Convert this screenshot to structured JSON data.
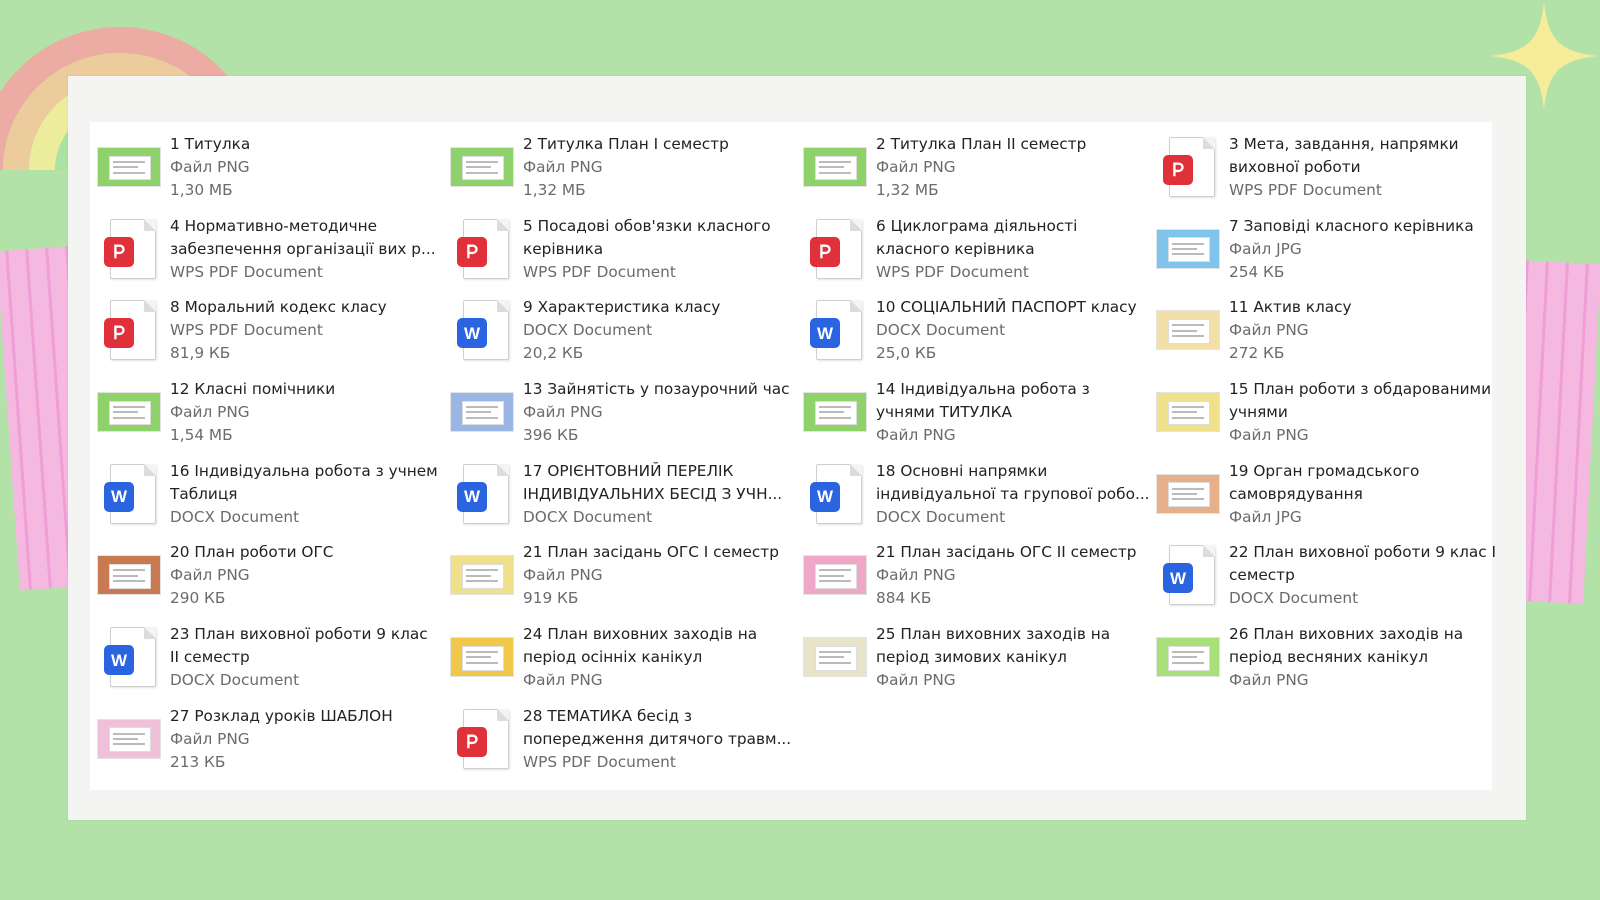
{
  "colors": {
    "background": "#b3e2a8",
    "sheet": "#f4f4f2",
    "panel": "#ffffff",
    "pdf_badge": "#e0303a",
    "word_badge": "#2a64e0",
    "tape": "#f7b6e4",
    "star": "#f7ec9a"
  },
  "icons": {
    "pdf": "wps-pdf-icon",
    "word": "word-docx-icon",
    "png": "image-thumbnail-icon",
    "jpg": "image-thumbnail-icon"
  },
  "files": [
    {
      "lines": [
        "1 Титулка"
      ],
      "type": "Файл PNG",
      "size": "1,30 МБ",
      "kind": "png",
      "tint": "#8fd16a"
    },
    {
      "lines": [
        "2 Титулка План І семестр"
      ],
      "type": "Файл PNG",
      "size": "1,32 МБ",
      "kind": "png",
      "tint": "#8fd16a"
    },
    {
      "lines": [
        "2 Титулка План ІІ семестр"
      ],
      "type": "Файл PNG",
      "size": "1,32 МБ",
      "kind": "png",
      "tint": "#8fd16a"
    },
    {
      "lines": [
        "3 Мета, завдання, напрямки",
        "виховної роботи"
      ],
      "type": "WPS PDF Document",
      "size": "",
      "kind": "pdf"
    },
    {
      "lines": [
        "4 Нормативно-методичне",
        "забезпечення організації вих р..."
      ],
      "type": "WPS PDF Document",
      "size": "",
      "kind": "pdf"
    },
    {
      "lines": [
        "5 Посадові обов'язки класного",
        "керівника"
      ],
      "type": "WPS PDF Document",
      "size": "",
      "kind": "pdf"
    },
    {
      "lines": [
        "6 Циклограма діяльності",
        "класного керівника"
      ],
      "type": "WPS PDF Document",
      "size": "",
      "kind": "pdf"
    },
    {
      "lines": [
        "7 Заповіді класного керівника"
      ],
      "type": "Файл JPG",
      "size": "254 КБ",
      "kind": "jpg",
      "tint": "#7fc4ec"
    },
    {
      "lines": [
        "8 Моральний кодекс класу"
      ],
      "type": "WPS PDF Document",
      "size": "81,9 КБ",
      "kind": "pdf"
    },
    {
      "lines": [
        "9 Характеристика класу"
      ],
      "type": "DOCX Document",
      "size": "20,2 КБ",
      "kind": "word"
    },
    {
      "lines": [
        "10 СОЦІАЛЬНИЙ ПАСПОРТ класу"
      ],
      "type": "DOCX Document",
      "size": "25,0 КБ",
      "kind": "word"
    },
    {
      "lines": [
        "11 Актив класу"
      ],
      "type": "Файл PNG",
      "size": "272 КБ",
      "kind": "png",
      "tint": "#f3dfa8"
    },
    {
      "lines": [
        "12 Класні помічники"
      ],
      "type": "Файл PNG",
      "size": "1,54 МБ",
      "kind": "png",
      "tint": "#8fd16a"
    },
    {
      "lines": [
        "13 Зайнятість у позаурочний час"
      ],
      "type": "Файл PNG",
      "size": "396 КБ",
      "kind": "png",
      "tint": "#9bb6e4"
    },
    {
      "lines": [
        "14 Індивідуальна робота з",
        "учнями ТИТУЛКА"
      ],
      "type": "Файл PNG",
      "size": "",
      "kind": "png",
      "tint": "#8fd16a"
    },
    {
      "lines": [
        "15 План роботи з обдарованими",
        "учнями"
      ],
      "type": "Файл PNG",
      "size": "",
      "kind": "png",
      "tint": "#f0e08a"
    },
    {
      "lines": [
        "16 Індивідуальна робота з учнем",
        "Таблиця"
      ],
      "type": "DOCX Document",
      "size": "",
      "kind": "word"
    },
    {
      "lines": [
        "17 ОРІЄНТОВНИЙ ПЕРЕЛІК",
        "ІНДИВІДУАЛЬНИХ БЕСІД З УЧН..."
      ],
      "type": "DOCX Document",
      "size": "",
      "kind": "word"
    },
    {
      "lines": [
        "18 Основні напрямки",
        "індивідуальної та групової робо..."
      ],
      "type": "DOCX Document",
      "size": "",
      "kind": "word"
    },
    {
      "lines": [
        "19 Орган громадського",
        "самоврядування"
      ],
      "type": "Файл JPG",
      "size": "",
      "kind": "jpg",
      "tint": "#e7b08c"
    },
    {
      "lines": [
        "20 План роботи ОГС"
      ],
      "type": "Файл PNG",
      "size": "290 КБ",
      "kind": "png",
      "tint": "#c97a52"
    },
    {
      "lines": [
        "21 План засідань ОГС І семестр"
      ],
      "type": "Файл PNG",
      "size": "919 КБ",
      "kind": "png",
      "tint": "#f0e08a"
    },
    {
      "lines": [
        "21 План засідань ОГС ІІ семестр"
      ],
      "type": "Файл PNG",
      "size": "884 КБ",
      "kind": "png",
      "tint": "#f0a8c8"
    },
    {
      "lines": [
        "22 План виховної роботи 9 клас І",
        "семестр"
      ],
      "type": "DOCX Document",
      "size": "",
      "kind": "word"
    },
    {
      "lines": [
        "23 План виховної роботи 9 клас",
        "ІІ семестр"
      ],
      "type": "DOCX Document",
      "size": "",
      "kind": "word"
    },
    {
      "lines": [
        "24 План виховних заходів на",
        "період осінніх канікул"
      ],
      "type": "Файл PNG",
      "size": "",
      "kind": "png",
      "tint": "#f2c84a"
    },
    {
      "lines": [
        "25 План виховних заходів на",
        "період зимових канікул"
      ],
      "type": "Файл PNG",
      "size": "",
      "kind": "png",
      "tint": "#e8e4c8"
    },
    {
      "lines": [
        "26 План виховних заходів на",
        "період весняних канікул"
      ],
      "type": "Файл PNG",
      "size": "",
      "kind": "png",
      "tint": "#a8e07a"
    },
    {
      "lines": [
        "27 Розклад уроків ШАБЛОН"
      ],
      "type": "Файл PNG",
      "size": "213 КБ",
      "kind": "png",
      "tint": "#f0c0d8"
    },
    {
      "lines": [
        "28 ТЕМАТИКА  бесід з",
        "попередження  дитячого травм..."
      ],
      "type": "WPS PDF Document",
      "size": "",
      "kind": "pdf"
    }
  ]
}
